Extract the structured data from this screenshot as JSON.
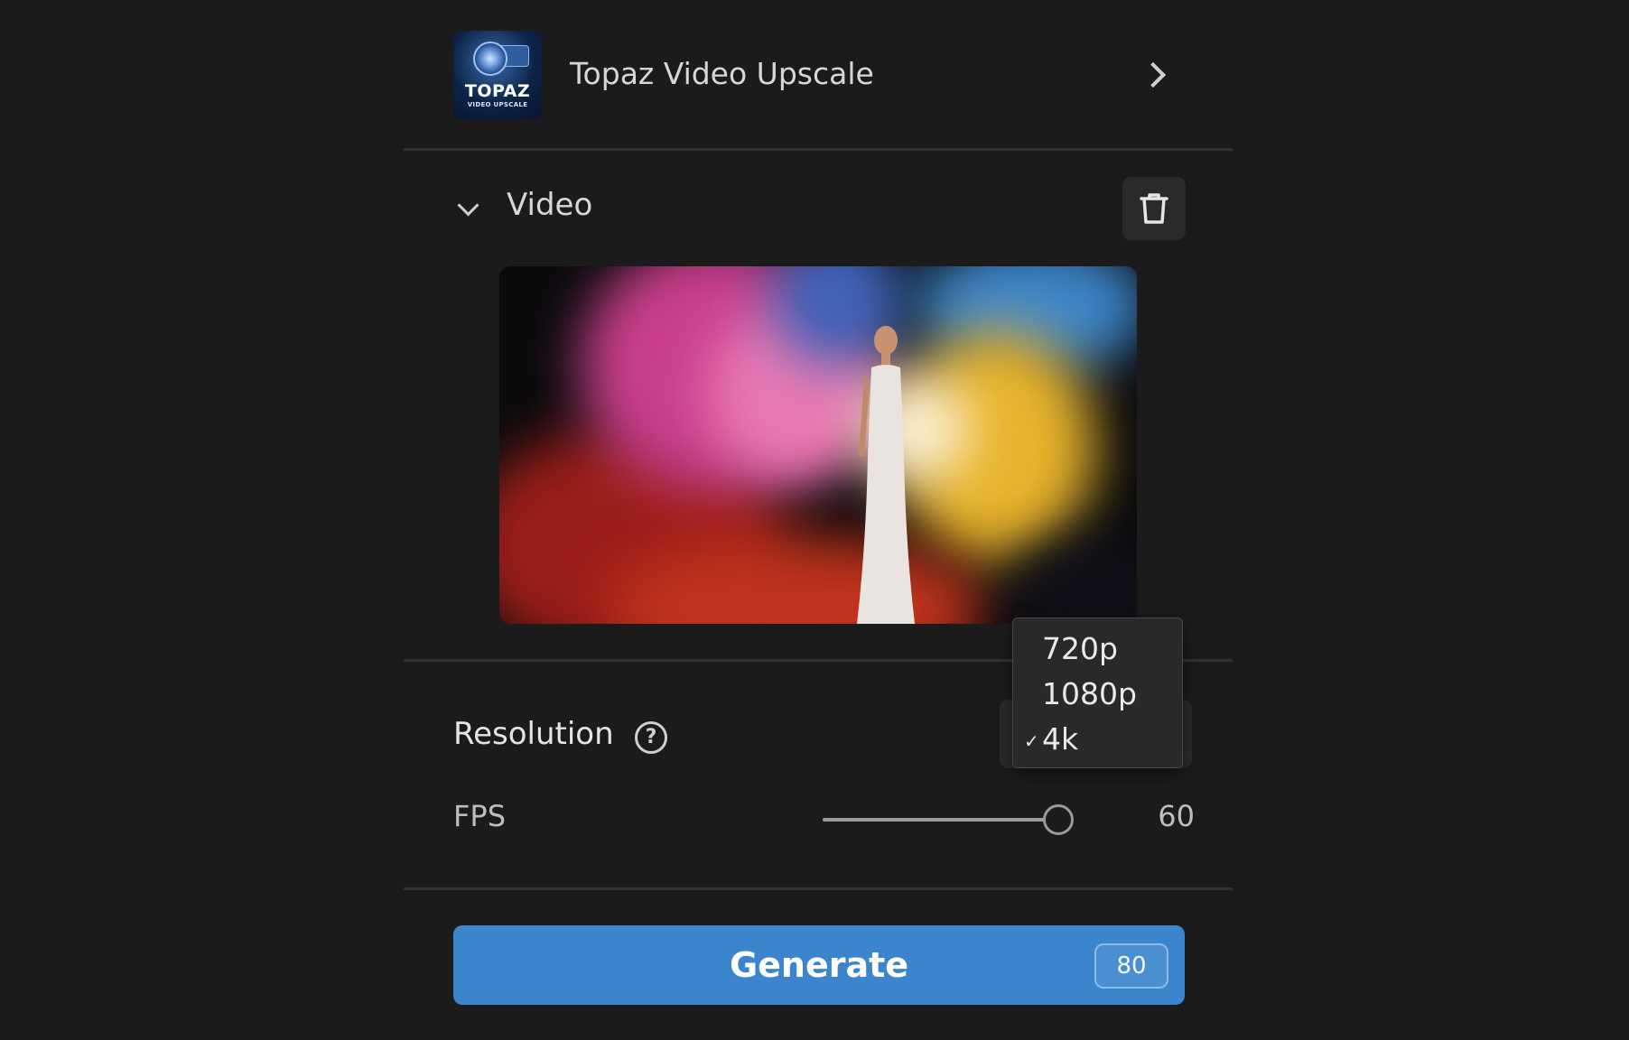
{
  "model": {
    "name": "Topaz Video Upscale",
    "thumb_title": "TOPAZ",
    "thumb_subtitle": "VIDEO UPSCALE"
  },
  "video_section": {
    "title": "Video",
    "expand_icon": "chevron-down-icon",
    "delete_icon": "trash-icon"
  },
  "settings": {
    "resolution_label": "Resolution",
    "resolution_options": [
      "720p",
      "1080p",
      "4k"
    ],
    "resolution_selected": "4k",
    "fps_label": "FPS",
    "fps_value": "60",
    "fps_fraction": 0.96
  },
  "generate": {
    "label": "Generate",
    "cost": "80",
    "color": "#3b85cc"
  }
}
